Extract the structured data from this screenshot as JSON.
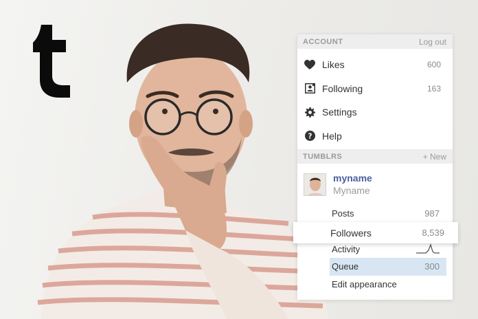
{
  "account": {
    "header": "ACCOUNT",
    "logout": "Log out",
    "items": [
      {
        "label": "Likes",
        "count": "600",
        "icon": "heart-icon"
      },
      {
        "label": "Following",
        "count": "163",
        "icon": "following-icon"
      },
      {
        "label": "Settings",
        "count": "",
        "icon": "gear-icon"
      },
      {
        "label": "Help",
        "count": "",
        "icon": "help-icon"
      }
    ]
  },
  "tumblrs": {
    "header": "TUMBLRS",
    "new_label": "+ New",
    "blog": {
      "name": "myname",
      "title": "Myname"
    },
    "stats": {
      "posts_label": "Posts",
      "posts_value": "987",
      "followers_label": "Followers",
      "followers_value": "8,539",
      "activity_label": "Activity",
      "queue_label": "Queue",
      "queue_value": "300",
      "edit_label": "Edit appearance"
    }
  },
  "colors": {
    "accent_blue": "#4a5fa0",
    "queue_highlight": "#d7e6f2"
  }
}
